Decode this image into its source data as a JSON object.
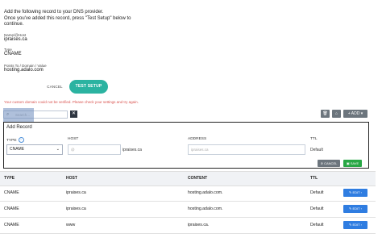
{
  "intro": {
    "line1": "Add the following record to your DNS provider.",
    "line2": "Once you've added this record, press \"Test Setup\" below to",
    "line3": "continue."
  },
  "record_info": {
    "name_label": "Name/@Host",
    "name_value": "ipraises.ca",
    "type_label": "Type",
    "type_value": "CNAME",
    "points_label": "Points To / Domain / Value",
    "points_value": "hosting.adalo.com"
  },
  "actions": {
    "cancel": "CANCEL",
    "test_setup": "TEST SETUP"
  },
  "error_message": "Your custom domain could not be verified. Please check your settings and try again.",
  "toolbar": {
    "search_placeholder": "Search...",
    "clear_label": "✕",
    "add_label": "+ ADD ▾"
  },
  "add_record": {
    "title": "Add Record",
    "type_label": "TYPE",
    "type_value": "CNAME",
    "host_label": "HOST",
    "host_placeholder": "@",
    "host_suffix": "ipraises.ca",
    "address_label": "ADDRESS",
    "address_placeholder": "ipraises.ca",
    "ttl_label": "TTL",
    "ttl_value": "Default",
    "cancel_label": "⊘ CANCEL",
    "save_label": "▣ SAVE"
  },
  "table": {
    "headers": {
      "type": "TYPE",
      "host": "HOST",
      "content": "CONTENT",
      "ttl": "TTL"
    },
    "rows": [
      {
        "type": "CNAME",
        "host": "ipraises.ca",
        "content": "hosting.adalo.com.",
        "ttl": "Default",
        "edit": "✎ EDIT ›"
      },
      {
        "type": "CNAME",
        "host": "ipraises.ca",
        "content": "hosting.adalo.com.",
        "ttl": "Default",
        "edit": "✎ EDIT ›"
      },
      {
        "type": "CNAME",
        "host": "www",
        "content": "ipraises.ca.",
        "ttl": "Default",
        "edit": "✎ EDIT ›"
      }
    ]
  },
  "colors": {
    "accent": "#2bb3a1",
    "error": "#d9534f",
    "edit": "#2f7de1",
    "save": "#28a745"
  }
}
